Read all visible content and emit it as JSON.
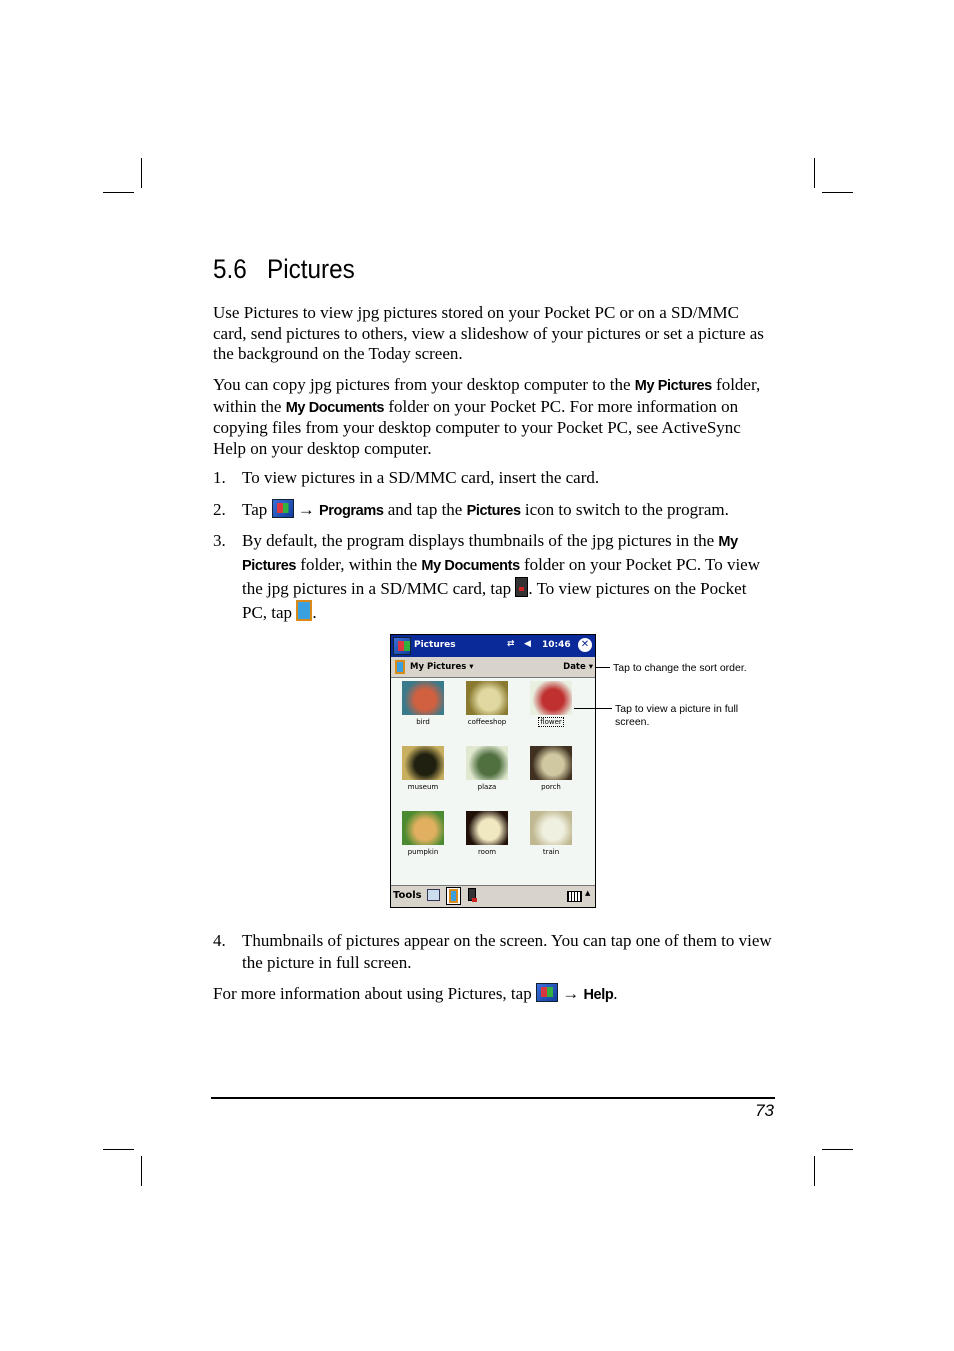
{
  "section": {
    "number": "5.6",
    "title": "Pictures"
  },
  "para1": "Use Pictures to view jpg pictures stored on your Pocket PC or on a SD/MMC card, send pictures to others, view a slideshow of your pictures or set a picture as the background on the Today screen.",
  "para2": {
    "a": "You can copy jpg pictures from your desktop computer to the ",
    "b1": "My Pictures",
    "c": " folder, within the ",
    "b2": "My Documents",
    "d": " folder on your Pocket PC. For more information on copying files from your desktop computer to your Pocket PC, see ActiveSync Help on your desktop computer."
  },
  "steps": [
    {
      "n": "1.",
      "text": "To view pictures in a SD/MMC card, insert the card."
    },
    {
      "n": "2.",
      "a": "Tap ",
      "arrow": "→",
      "b1": "Programs",
      "c": " and tap the ",
      "b2": "Pictures",
      "d": " icon to switch to the program."
    },
    {
      "n": "3.",
      "a": "By default, the program displays thumbnails of the jpg pictures in the ",
      "b1": "My Pictures",
      "c": " folder, within the ",
      "b2": "My Documents",
      "d": " folder on your Pocket PC. To view the jpg pictures in a SD/MMC card, tap ",
      "e": ". To view pictures on the Pocket PC, tap ",
      "f": "."
    },
    {
      "n": "4.",
      "text": "Thumbnails of pictures appear on the screen. You can tap one of them to view the picture in full screen."
    }
  ],
  "para_last": {
    "a": "For more information about using Pictures, tap ",
    "arrow": "→",
    "b": "Help",
    "c": "."
  },
  "device": {
    "title": "Pictures",
    "time": "10:46",
    "folder": "My Pictures",
    "sort": "Date",
    "thumbnails": [
      {
        "label": "bird",
        "colors": [
          "#3a7a8a",
          "#d06040"
        ]
      },
      {
        "label": "coffeeshop",
        "colors": [
          "#8a7a30",
          "#e0d8a0"
        ]
      },
      {
        "label": "flower",
        "colors": [
          "#e8f0e0",
          "#c03030"
        ]
      },
      {
        "label": "museum",
        "colors": [
          "#c8b060",
          "#202010"
        ]
      },
      {
        "label": "plaza",
        "colors": [
          "#e0e8d0",
          "#507040"
        ]
      },
      {
        "label": "porch",
        "colors": [
          "#403020",
          "#d0c8a0"
        ]
      },
      {
        "label": "pumpkin",
        "colors": [
          "#4a8a30",
          "#e0b060"
        ]
      },
      {
        "label": "room",
        "colors": [
          "#201008",
          "#f0e8c0"
        ]
      },
      {
        "label": "train",
        "colors": [
          "#c0b890",
          "#f0f0e0"
        ]
      }
    ],
    "tools": "Tools"
  },
  "callouts": [
    "Tap to change the sort order.",
    "Tap to view a picture in full screen."
  ],
  "page_number": "73"
}
